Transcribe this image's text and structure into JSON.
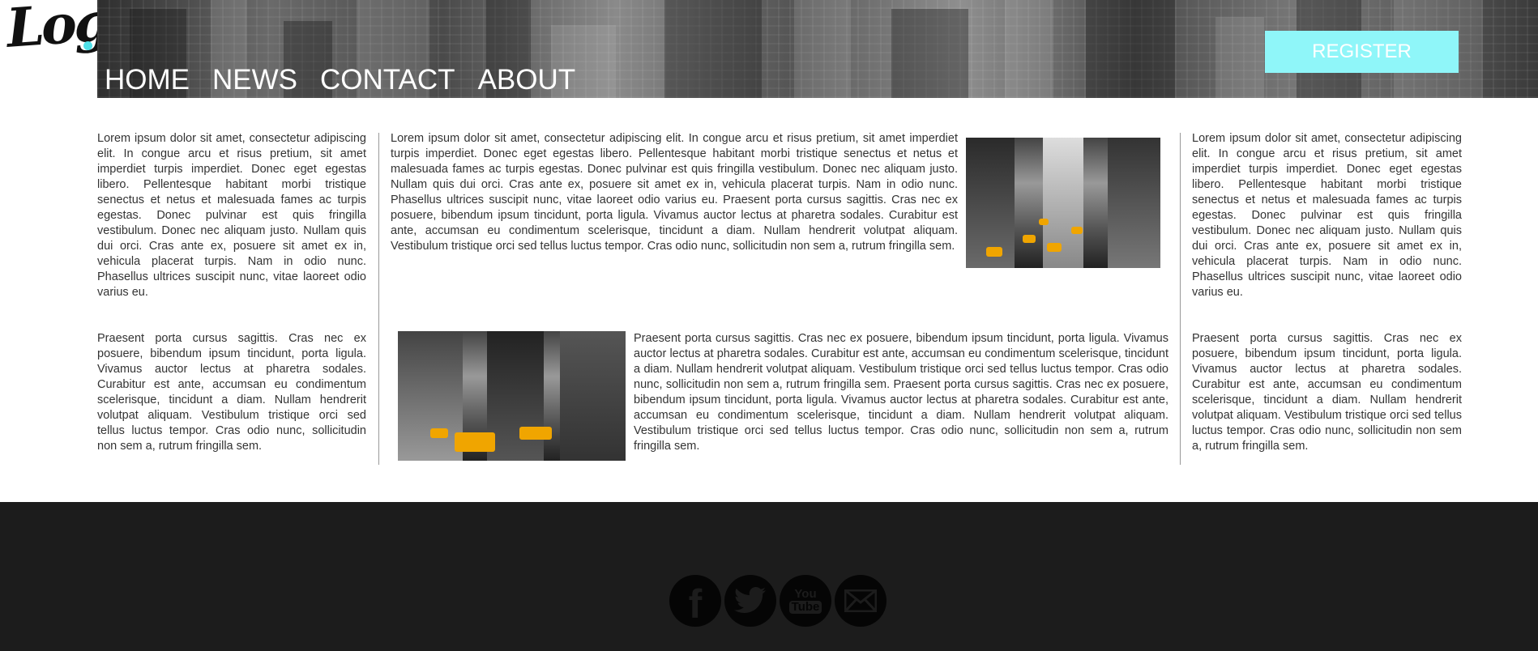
{
  "header": {
    "logo_text": "Logo",
    "nav": [
      "HOME",
      "NEWS",
      "CONTACT",
      "ABOUT"
    ],
    "register_label": "REGISTER"
  },
  "columns": {
    "left": {
      "p1": "Lorem ipsum dolor sit amet, consectetur adipiscing elit. In congue arcu et risus pretium, sit amet imperdiet turpis imperdiet. Donec eget egestas libero. Pellentesque habitant morbi tristique senectus et netus et malesuada fames ac turpis egestas. Donec pulvinar est quis fringilla vestibulum. Donec nec aliquam justo. Nullam quis dui orci. Cras ante ex, posuere sit amet ex in, vehicula placerat turpis. Nam in odio nunc. Phasellus ultrices suscipit nunc, vitae laoreet odio varius eu.",
      "p2": "Praesent porta cursus sagittis. Cras nec ex posuere, bibendum ipsum tincidunt, porta ligula. Vivamus auctor lectus at pharetra sodales. Curabitur est ante, accumsan eu condimentum scelerisque, tincidunt a diam. Nullam hendrerit volutpat aliquam. Vestibulum tristique orci sed tellus luctus tempor. Cras odio nunc, sollicitudin non sem a, rutrum fringilla sem."
    },
    "middle": {
      "p1": "Lorem ipsum dolor sit amet, consectetur adipiscing elit. In congue arcu et risus pretium, sit amet imperdiet turpis imperdiet. Donec eget egestas libero. Pellentesque habitant morbi tristique senectus et netus et malesuada fames ac turpis egestas. Donec pulvinar est quis fringilla vestibulum. Donec nec aliquam justo. Nullam quis dui orci. Cras ante ex, posuere sit amet ex in, vehicula placerat turpis. Nam in odio nunc. Phasellus ultrices suscipit nunc, vitae laoreet odio varius eu. Praesent porta cursus sagittis. Cras nec ex posuere, bibendum ipsum tincidunt, porta ligula. Vivamus auctor lectus at pharetra sodales. Curabitur est ante, accumsan eu condimentum scelerisque, tincidunt a diam. Nullam hendrerit volutpat aliquam. Vestibulum tristique orci sed tellus luctus tempor. Cras odio nunc, sollicitudin non sem a, rutrum fringilla sem.",
      "p2": "Praesent porta cursus sagittis. Cras nec ex posuere, bibendum ipsum tincidunt, porta ligula. Vivamus auctor lectus at pharetra sodales. Curabitur est ante, accumsan eu condimentum scelerisque, tincidunt a diam. Nullam hendrerit volutpat aliquam. Vestibulum tristique orci sed tellus luctus tempor. Cras odio nunc, sollicitudin non sem a, rutrum fringilla sem. Praesent porta cursus sagittis. Cras nec ex posuere, bibendum ipsum tincidunt, porta ligula. Vivamus auctor lectus at pharetra sodales. Curabitur est ante, accumsan eu condimentum scelerisque, tincidunt a diam. Nullam hendrerit volutpat aliquam. Vestibulum tristique orci sed tellus luctus tempor. Cras odio nunc, sollicitudin non sem a, rutrum fringilla sem."
    },
    "right": {
      "p1": "Lorem ipsum dolor sit amet, consectetur adipiscing elit. In congue arcu et risus pretium, sit amet imperdiet turpis imperdiet. Donec eget egestas libero. Pellentesque habitant morbi tristique senectus et netus et malesuada fames ac turpis egestas. Donec pulvinar est quis fringilla vestibulum. Donec nec aliquam justo. Nullam quis dui orci. Cras ante ex, posuere sit amet ex in, vehicula placerat turpis. Nam in odio nunc. Phasellus ultrices suscipit nunc, vitae laoreet odio varius eu.",
      "p2": "Praesent porta cursus sagittis. Cras nec ex posuere, bibendum ipsum tincidunt, porta ligula. Vivamus auctor lectus at pharetra sodales. Curabitur est ante, accumsan eu condimentum scelerisque, tincidunt a diam. Nullam hendrerit volutpat aliquam. Vestibulum tristique orci sed tellus luctus tempor. Cras odio nunc, sollicitudin non sem a, rutrum fringilla sem."
    }
  },
  "footer": {
    "social": {
      "facebook_glyph": "f",
      "youtube_top": "You",
      "youtube_bottom": "Tube"
    }
  },
  "colors": {
    "accent": "#8ff6f9",
    "footer_bg": "#1c1c1c",
    "text": "#333333"
  },
  "icons": [
    "facebook-icon",
    "twitter-icon",
    "youtube-icon",
    "mail-icon"
  ]
}
